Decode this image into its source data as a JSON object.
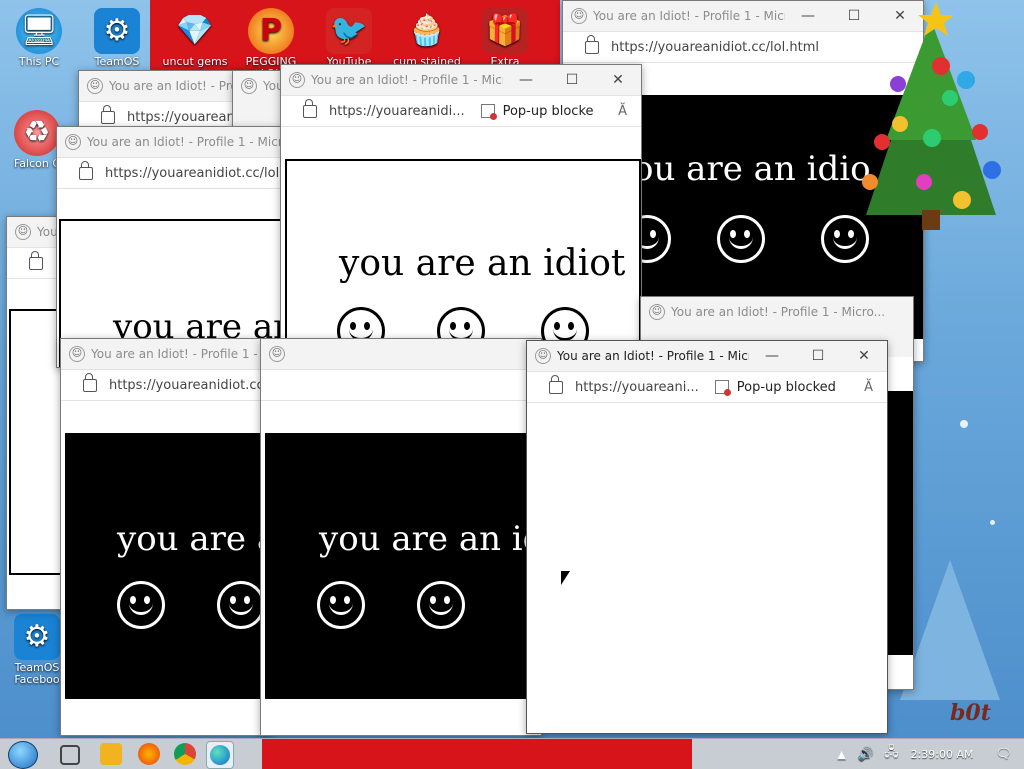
{
  "desktop": {
    "icons": [
      {
        "label": "This PC",
        "glyph": "🖥"
      },
      {
        "label": "TeamOS",
        "glyph": "⚙"
      },
      {
        "label": "uncut gems",
        "glyph": "💎"
      },
      {
        "label": "PEGGING LOL",
        "glyph": "P"
      },
      {
        "label": "YouTube",
        "glyph": "🐦"
      },
      {
        "label": "cum stained",
        "glyph": "🧁"
      },
      {
        "label": "Extra",
        "glyph": "🎁"
      },
      {
        "label": "Falcon C",
        "glyph": "♻"
      },
      {
        "label": "TeamOS Faceboo",
        "glyph": "⚙"
      }
    ],
    "wallpaper_text": "b0t"
  },
  "browser": {
    "title": "You are an Idiot! - Profile 1 - Micro...",
    "title_short": "You are an Idiot! - Profi",
    "title_tiny": "You",
    "url_full": "https://youareanidiot.cc/lol.html",
    "url_mid": "https://youareanidi...",
    "url_trunc": "https://youareani...",
    "url_cut1": "https://youarean",
    "url_cut2": "https://youareanidiot.cc/lol.",
    "url_cut3": "https://youareanidiot.cc",
    "url_far": "https://youareanidiot.cc/lol.html",
    "popup_blocked": "Pop-up blocked",
    "popup_blocked_cut": "Pop-up blocke",
    "read_aloud": "Ă",
    "minimize": "—",
    "maximize": "☐",
    "close": "✕"
  },
  "page": {
    "slogan": "you are an idiot",
    "slogan_cut1": "you are an",
    "slogan_cut2": "you are a",
    "slogan_cut3": "you are an id",
    "slogan_cut4": "ou are an idio"
  },
  "taskbar": {
    "time": "2:39:00 AM"
  },
  "colors": {
    "accent_red": "#d8141b",
    "page_black": "#000000",
    "page_white": "#ffffff"
  }
}
